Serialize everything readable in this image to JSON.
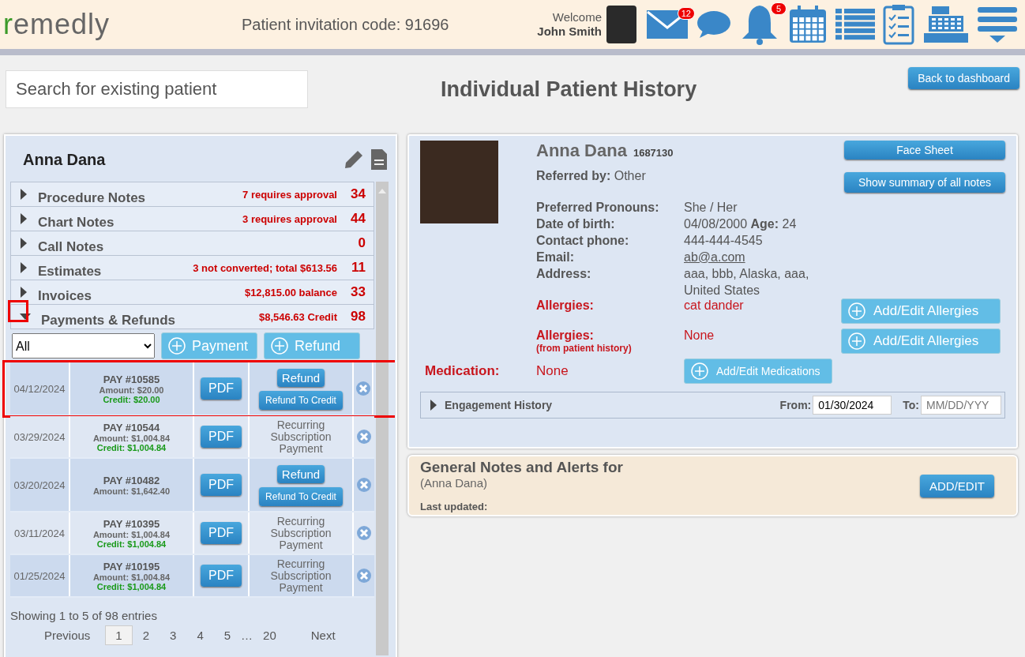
{
  "header": {
    "logo": "remedly",
    "invitation": "Patient invitation code: 91696",
    "welcome": "Welcome",
    "user_name": "John Smith",
    "icons": [
      {
        "kind": "mail",
        "badge": "12"
      },
      {
        "kind": "chat"
      },
      {
        "kind": "bell",
        "badge": "5"
      },
      {
        "kind": "calendar"
      },
      {
        "kind": "list"
      },
      {
        "kind": "checklist"
      },
      {
        "kind": "register"
      },
      {
        "kind": "menu"
      }
    ]
  },
  "search": {
    "placeholder": "Search for existing patient"
  },
  "page_title": "Individual Patient History",
  "back_button": "Back to dashboard",
  "left_panel": {
    "patient_name": "Anna Dana",
    "sections": [
      {
        "label": "Procedure Notes",
        "note": "7 requires approval",
        "count": "34",
        "expanded": false,
        "highlighted": false
      },
      {
        "label": "Chart Notes",
        "note": "3 requires approval",
        "count": "44",
        "expanded": false,
        "highlighted": false
      },
      {
        "label": "Call Notes",
        "count": "0",
        "expanded": false,
        "highlighted": false
      },
      {
        "label": "Estimates",
        "note": "3 not converted; total $613.56",
        "count": "11",
        "expanded": false,
        "highlighted": false
      },
      {
        "label": "Invoices",
        "note": "$12,815.00 balance",
        "count": "33",
        "expanded": false,
        "highlighted": false
      },
      {
        "label": "Payments & Refunds",
        "note": "$8,546.63 Credit",
        "count": "98",
        "expanded": true,
        "highlighted": true
      }
    ],
    "filter": {
      "value": "All"
    },
    "add_buttons": [
      "Payment",
      "Refund"
    ],
    "payments": [
      {
        "date": "04/12/2024",
        "pay_id": "PAY #10585",
        "amount": "Amount: $20.00",
        "credit": "Credit: $20.00",
        "pdf": "PDF",
        "kind": "buttons",
        "actions": [
          "Refund",
          "Refund To Credit"
        ],
        "highlighted": true
      },
      {
        "date": "03/29/2024",
        "pay_id": "PAY #10544",
        "amount": "Amount: $1,004.84",
        "credit": "Credit: $1,004.84",
        "pdf": "PDF",
        "kind": "text",
        "action_text": "Recurring Subscription Payment",
        "highlighted": false
      },
      {
        "date": "03/20/2024",
        "pay_id": "PAY #10482",
        "amount": "Amount: $1,642.40",
        "pdf": "PDF",
        "kind": "buttons",
        "actions": [
          "Refund",
          "Refund To Credit"
        ],
        "highlighted": false
      },
      {
        "date": "03/11/2024",
        "pay_id": "PAY #10395",
        "amount": "Amount: $1,004.84",
        "credit": "Credit: $1,004.84",
        "pdf": "PDF",
        "kind": "text",
        "action_text": "Recurring Subscription Payment",
        "highlighted": false
      },
      {
        "date": "01/25/2024",
        "pay_id": "PAY #10195",
        "amount": "Amount: $1,004.84",
        "credit": "Credit: $1,004.84",
        "pdf": "PDF",
        "kind": "text",
        "action_text": "Recurring Subscription Payment",
        "highlighted": false
      }
    ],
    "entries_info": "Showing 1 to 5 of 98 entries",
    "pagination": {
      "previous": "Previous",
      "next": "Next",
      "pages": [
        {
          "kind": "page",
          "label": "1",
          "selected": true
        },
        {
          "kind": "page",
          "label": "2",
          "selected": false
        },
        {
          "kind": "page",
          "label": "3",
          "selected": false
        },
        {
          "kind": "page",
          "label": "4",
          "selected": false
        },
        {
          "kind": "page",
          "label": "5",
          "selected": false
        },
        {
          "kind": "ellipsis",
          "label": "…"
        },
        {
          "kind": "page",
          "label": "20",
          "selected": false
        }
      ]
    }
  },
  "patient": {
    "name": "Anna Dana",
    "id": "1687130",
    "referred_label": "Referred by:",
    "referred_value": "Other",
    "fields": [
      {
        "label": "Preferred Pronouns:",
        "value": "She / Her",
        "kind": "text"
      },
      {
        "label": "Date of birth:",
        "value": "04/08/2000 **Age:** 24",
        "kind": "text"
      },
      {
        "label": "Contact phone:",
        "value": "444-444-4545",
        "kind": "text"
      },
      {
        "label": "Email:",
        "value": "ab@a.com",
        "kind": "link"
      },
      {
        "label": "Address:",
        "value": "aaa, bbb, Alaska, aaa, United States",
        "kind": "text"
      }
    ],
    "allergies": [
      {
        "label": "Allergies:",
        "value": "cat dander",
        "button": "Add/Edit Allergies"
      },
      {
        "label": "Allergies:",
        "sublabel": "(from patient history)",
        "value": "None",
        "button": "Add/Edit Allergies"
      }
    ],
    "medication": {
      "label": "Medication:",
      "value": "None",
      "button": "Add/Edit Medications"
    },
    "buttons": [
      "Face Sheet",
      "Show summary of all notes"
    ],
    "engagement": {
      "label": "Engagement History",
      "expanded": false,
      "from_label": "From:",
      "from_value": "01/30/2024",
      "to_label": "To:",
      "to_placeholder": "MM/DD/YYY"
    }
  },
  "notes": {
    "title": "General Notes and Alerts for",
    "subtitle": "(Anna Dana)",
    "last_updated": "Last updated:",
    "button": "ADD/EDIT"
  }
}
